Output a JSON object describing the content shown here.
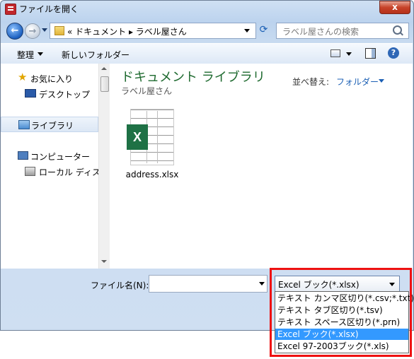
{
  "window": {
    "title": "ファイルを開く",
    "close_label": "x"
  },
  "address": {
    "breadcrumb": "« ドキュメント ▸ ラベル屋さん"
  },
  "search": {
    "placeholder": "ラベル屋さんの検索"
  },
  "toolbar": {
    "organize_label": "整理",
    "new_folder_label": "新しいフォルダー",
    "help_label": "?"
  },
  "navigation": {
    "items": [
      {
        "label": "お気に入り",
        "icon": "star-icon"
      },
      {
        "label": "デスクトップ",
        "icon": "desktop-icon"
      },
      {
        "label": "ライブラリ",
        "icon": "library-icon"
      },
      {
        "label": "コンピューター",
        "icon": "computer-icon"
      },
      {
        "label": "ローカル ディスク",
        "icon": "local-disk-icon"
      }
    ]
  },
  "content": {
    "library_title": "ドキュメント ライブラリ",
    "library_subtitle": "ラベル屋さん",
    "arrange_label": "並べ替え:",
    "arrange_value": "フォルダー",
    "files": [
      {
        "name": "address.xlsx",
        "icon": "excel-file-icon",
        "badge": "X"
      }
    ]
  },
  "bottom": {
    "filename_label": "ファイル名(N):",
    "filename_value": "",
    "filetype_selected": "Excel ブック(*.xlsx)",
    "filetype_options": [
      "テキスト カンマ区切り(*.csv;*.txt)",
      "テキスト タブ区切り(*.tsv)",
      "テキスト スペース区切り(*.prn)",
      "Excel ブック(*.xlsx)",
      "Excel 97-2003ブック(*.xls)"
    ]
  },
  "colors": {
    "library_title": "#1e6a2f",
    "highlight": "#ee1111",
    "selected_option": "#3399ff"
  }
}
